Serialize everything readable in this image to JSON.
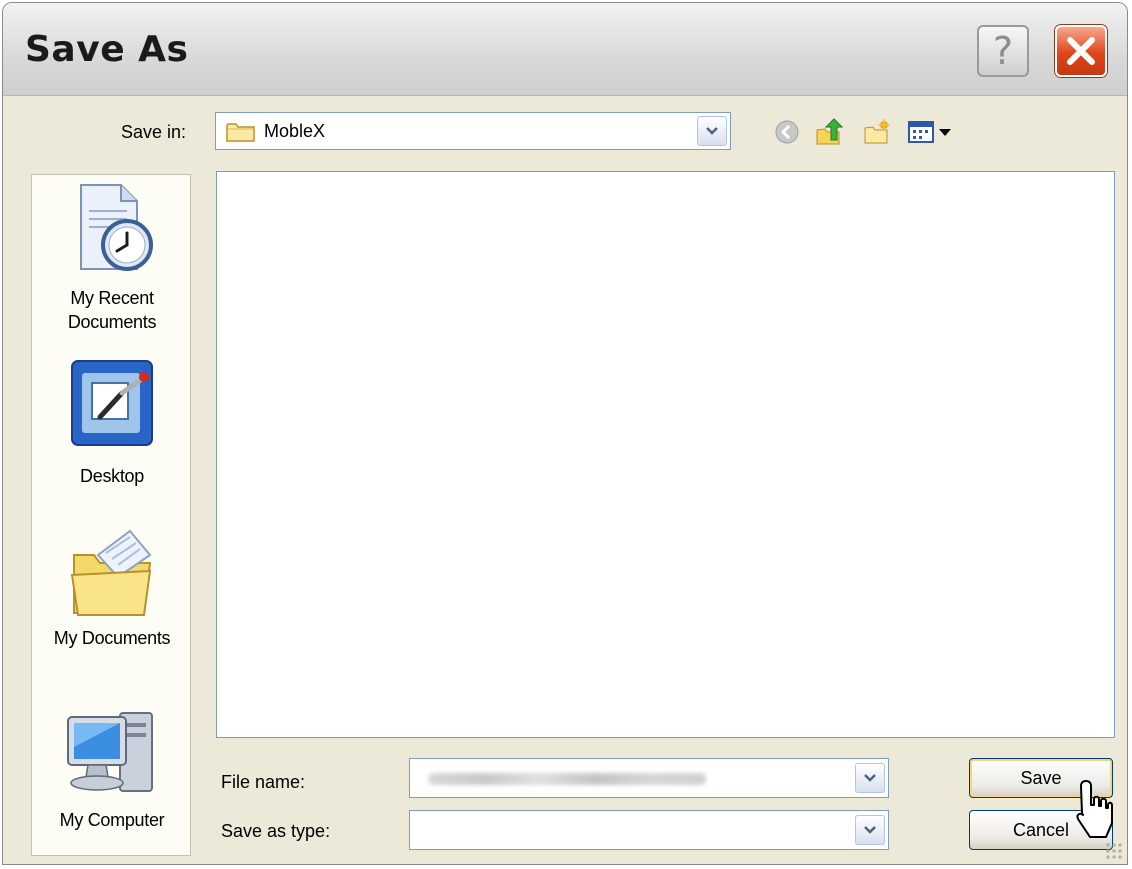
{
  "window": {
    "title": "Save As",
    "help_symbol": "?",
    "icons": {
      "help": "help-icon",
      "close": "close-icon"
    }
  },
  "save_in": {
    "label": "Save in:",
    "value": "MobleX",
    "icon": "folder-icon"
  },
  "toolbar": {
    "icons": [
      "back-icon",
      "up-one-level-icon",
      "new-folder-icon",
      "views-menu-icon"
    ]
  },
  "places": [
    {
      "label_line1": "My Recent",
      "label_line2": "Documents",
      "icon": "recent-documents-icon"
    },
    {
      "label_line1": "Desktop",
      "icon": "desktop-icon"
    },
    {
      "label_line1": "My Documents",
      "icon": "my-documents-icon"
    },
    {
      "label_line1": "My Computer",
      "icon": "my-computer-icon"
    }
  ],
  "file_name": {
    "label": "File name:",
    "value": ""
  },
  "save_as_type": {
    "label": "Save as type:",
    "value": ""
  },
  "buttons": {
    "save": "Save",
    "cancel": "Cancel"
  },
  "colors": {
    "dialog_background": "#ece9d8",
    "close_button": "#e0451c",
    "field_border": "#7f9db9",
    "default_button_glow": "#f8d57a"
  }
}
